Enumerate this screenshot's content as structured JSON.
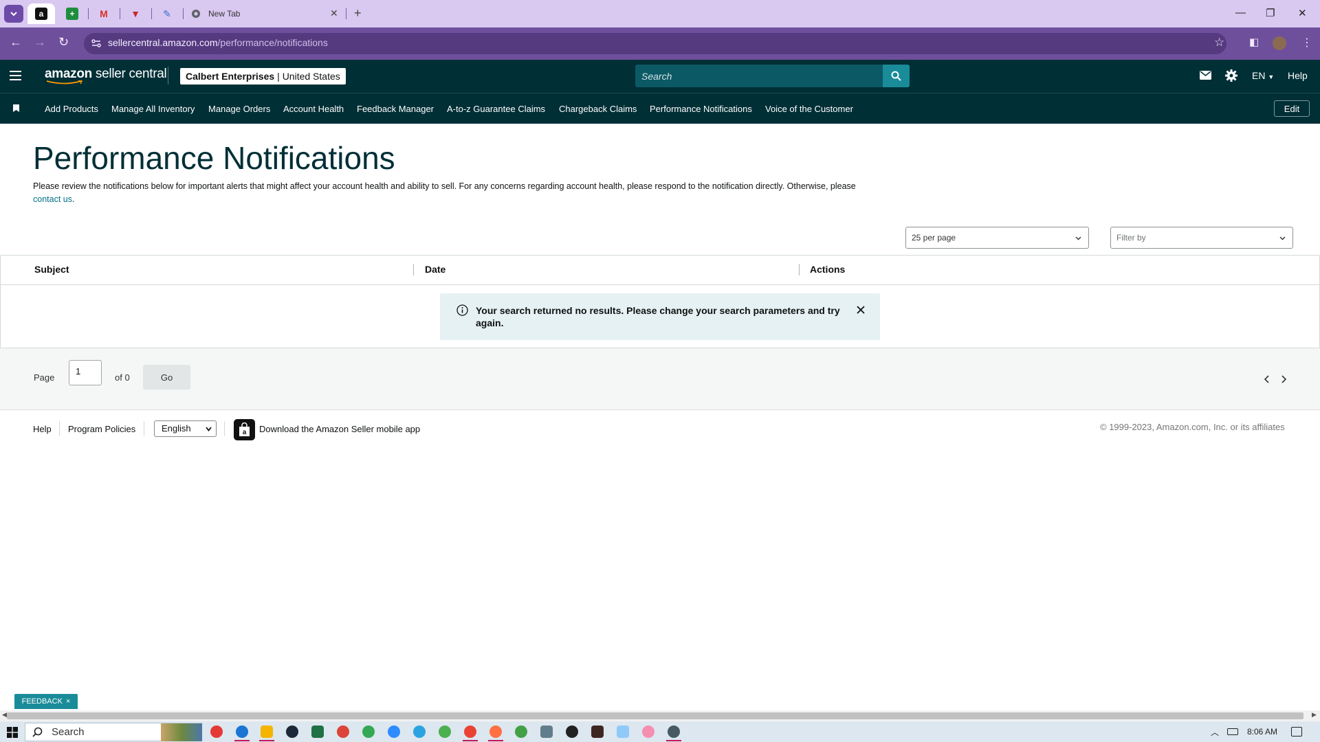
{
  "browser": {
    "tabs": [
      {
        "title": "",
        "icon": "amazon-a-icon",
        "active": true
      },
      {
        "title": "",
        "icon": "sheets-icon"
      },
      {
        "title": "",
        "icon": "gmail-icon"
      },
      {
        "title": "",
        "icon": "shield-v-icon"
      },
      {
        "title": "",
        "icon": "pen-icon"
      },
      {
        "title": "New Tab",
        "icon": "chrome-icon"
      }
    ],
    "url_host": "sellercentral.amazon.com",
    "url_path": "/performance/notifications"
  },
  "header": {
    "logo_bold": "amazon",
    "logo_rest": " seller central",
    "store_name": "Calbert Enterprises",
    "store_region": "| United States",
    "search_placeholder": "Search",
    "language": "EN",
    "help": "Help"
  },
  "nav": {
    "items": [
      "Add Products",
      "Manage All Inventory",
      "Manage Orders",
      "Account Health",
      "Feedback Manager",
      "A-to-z Guarantee Claims",
      "Chargeback Claims",
      "Performance Notifications",
      "Voice of the Customer"
    ],
    "edit": "Edit"
  },
  "page": {
    "title": "Performance Notifications",
    "description": "Please review the notifications below for important alerts that might affect your account health and ability to sell. For any concerns regarding account health, please respond to the notification directly. Otherwise, please ",
    "contact_link": "contact us",
    "contact_tail": ".",
    "per_page": "25 per page",
    "filter_placeholder": "Filter by"
  },
  "table": {
    "columns": [
      "Subject",
      "Date",
      "Actions"
    ],
    "empty_message": "Your search returned no results. Please change your search parameters and try again."
  },
  "pager": {
    "page_label": "Page",
    "page_value": "1",
    "of_label": "of 0",
    "go": "Go"
  },
  "footer": {
    "help": "Help",
    "program_policies": "Program Policies",
    "language": "English",
    "app_text": "Download the Amazon Seller mobile app",
    "copyright": "© 1999-2023, Amazon.com, Inc. or its affiliates"
  },
  "feedback": {
    "label": "FEEDBACK",
    "close": "×"
  },
  "taskbar": {
    "search": "Search",
    "time": "8:06 AM"
  },
  "colors": {
    "header_bg": "#002f36",
    "accent_teal": "#1a8c99",
    "link": "#007185",
    "browser_frame": "#6e4f9c"
  }
}
